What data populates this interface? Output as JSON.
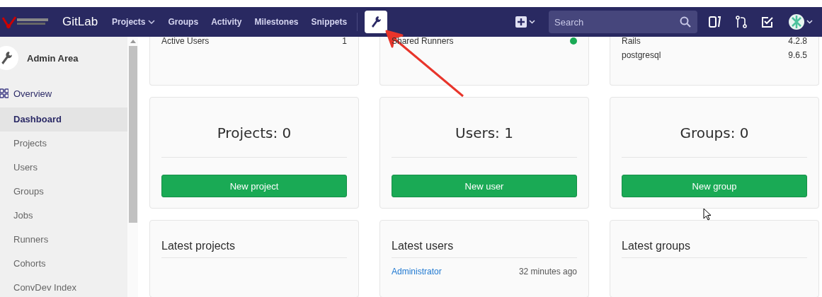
{
  "navbar": {
    "brand": "GitLab",
    "links": [
      {
        "label": "Projects",
        "dropdown": true
      },
      {
        "label": "Groups",
        "dropdown": false
      },
      {
        "label": "Activity",
        "dropdown": false
      },
      {
        "label": "Milestones",
        "dropdown": false
      },
      {
        "label": "Snippets",
        "dropdown": false
      }
    ],
    "admin_selected": true,
    "search": {
      "placeholder": "Search"
    }
  },
  "sidebar": {
    "title": "Admin Area",
    "section": "Overview",
    "items": [
      {
        "label": "Dashboard",
        "selected": true
      },
      {
        "label": "Projects",
        "selected": false
      },
      {
        "label": "Users",
        "selected": false
      },
      {
        "label": "Groups",
        "selected": false
      },
      {
        "label": "Jobs",
        "selected": false
      },
      {
        "label": "Runners",
        "selected": false
      },
      {
        "label": "Cohorts",
        "selected": false
      },
      {
        "label": "ConvDev Index",
        "selected": false
      }
    ]
  },
  "info_cards": [
    {
      "rows": [
        {
          "kind": "value",
          "label": "Active Users",
          "value": "1"
        }
      ]
    },
    {
      "rows": [
        {
          "kind": "status",
          "label": "Shared Runners",
          "color": "#1aaa55"
        }
      ]
    },
    {
      "rows": [
        {
          "kind": "value",
          "label": "Rails",
          "value": "4.2.8"
        },
        {
          "kind": "value",
          "label": "postgresql",
          "value": "9.6.5"
        }
      ]
    }
  ],
  "stat_cards": [
    {
      "title": "Projects: 0",
      "button": "New project"
    },
    {
      "title": "Users: 1",
      "button": "New user"
    },
    {
      "title": "Groups: 0",
      "button": "New group"
    }
  ],
  "latest_cards": [
    {
      "title": "Latest projects"
    },
    {
      "title": "Latest users",
      "rows": [
        {
          "name": "Administrator",
          "time": "32 minutes ago"
        }
      ]
    },
    {
      "title": "Latest groups"
    }
  ]
}
